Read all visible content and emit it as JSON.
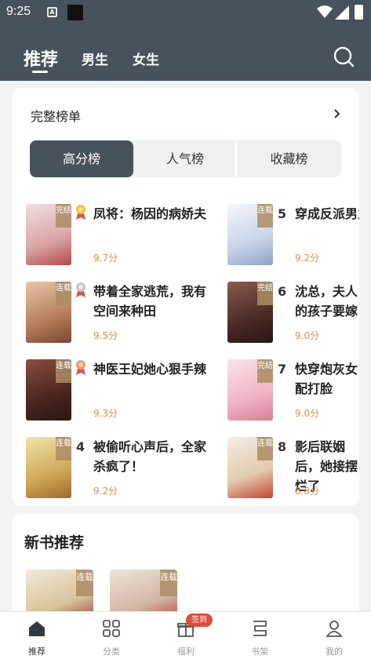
{
  "status": {
    "time": "9:25",
    "a_icon": "A"
  },
  "header": {
    "tabs": [
      {
        "label": "推荐",
        "active": true
      },
      {
        "label": "男生",
        "active": false
      },
      {
        "label": "女生",
        "active": false
      }
    ],
    "search_icon": "search-icon"
  },
  "rank": {
    "title": "完整榜单",
    "segments": [
      "高分榜",
      "人气榜",
      "收藏榜"
    ],
    "books": [
      {
        "rank": "1",
        "title": "凤将：杨因的病娇夫",
        "score": "9.7分",
        "tag": "完结",
        "cover_color": "#e8c9c9"
      },
      {
        "rank": "2",
        "title": "带着全家逃荒，我有空间来种田",
        "score": "9.5分",
        "tag": "连载",
        "cover_color": "#c9a58a"
      },
      {
        "rank": "3",
        "title": "神医王妃她心狠手辣",
        "score": "9.3分",
        "tag": "连载",
        "cover_color": "#6b3b32"
      },
      {
        "rank": "4",
        "title": "被偷听心声后，全家杀疯了！",
        "score": "9.2分",
        "tag": "连载",
        "cover_color": "#d9c27a"
      },
      {
        "rank": "5",
        "title": "穿成反派男主的前妻后，我",
        "score": "9.2分",
        "tag": "连载",
        "cover_color": "#dfe4ee"
      },
      {
        "rank": "6",
        "title": "沈总，夫人的孩子要嫁",
        "score": "9.0分",
        "tag": "完结",
        "cover_color": "#5c3a34"
      },
      {
        "rank": "7",
        "title": "快穿炮灰女配打脸",
        "score": "9.0分",
        "tag": "完结",
        "cover_color": "#f0c6cf"
      },
      {
        "rank": "8",
        "title": "影后联姻后，她接摆烂了",
        "score": "8.8分",
        "tag": "连载",
        "cover_color": "#eadfcf"
      }
    ]
  },
  "new_books": {
    "title": "新书推荐",
    "items": [
      {
        "tag": "连载",
        "cover_color": "#e9dfcc"
      },
      {
        "tag": "连载",
        "cover_color": "#e7d4c8"
      }
    ]
  },
  "bottom_nav": [
    {
      "label": "推荐",
      "icon": "home-icon",
      "active": true
    },
    {
      "label": "分类",
      "icon": "grid-icon",
      "active": false
    },
    {
      "label": "福利",
      "icon": "gift-icon",
      "active": false,
      "badge": "签到"
    },
    {
      "label": "书架",
      "icon": "bookshelf-icon",
      "active": false
    },
    {
      "label": "我的",
      "icon": "profile-icon",
      "active": false
    }
  ],
  "colors": {
    "header_bg": "#48525c",
    "score": "#d9904a",
    "badge": "#e04a3a"
  }
}
